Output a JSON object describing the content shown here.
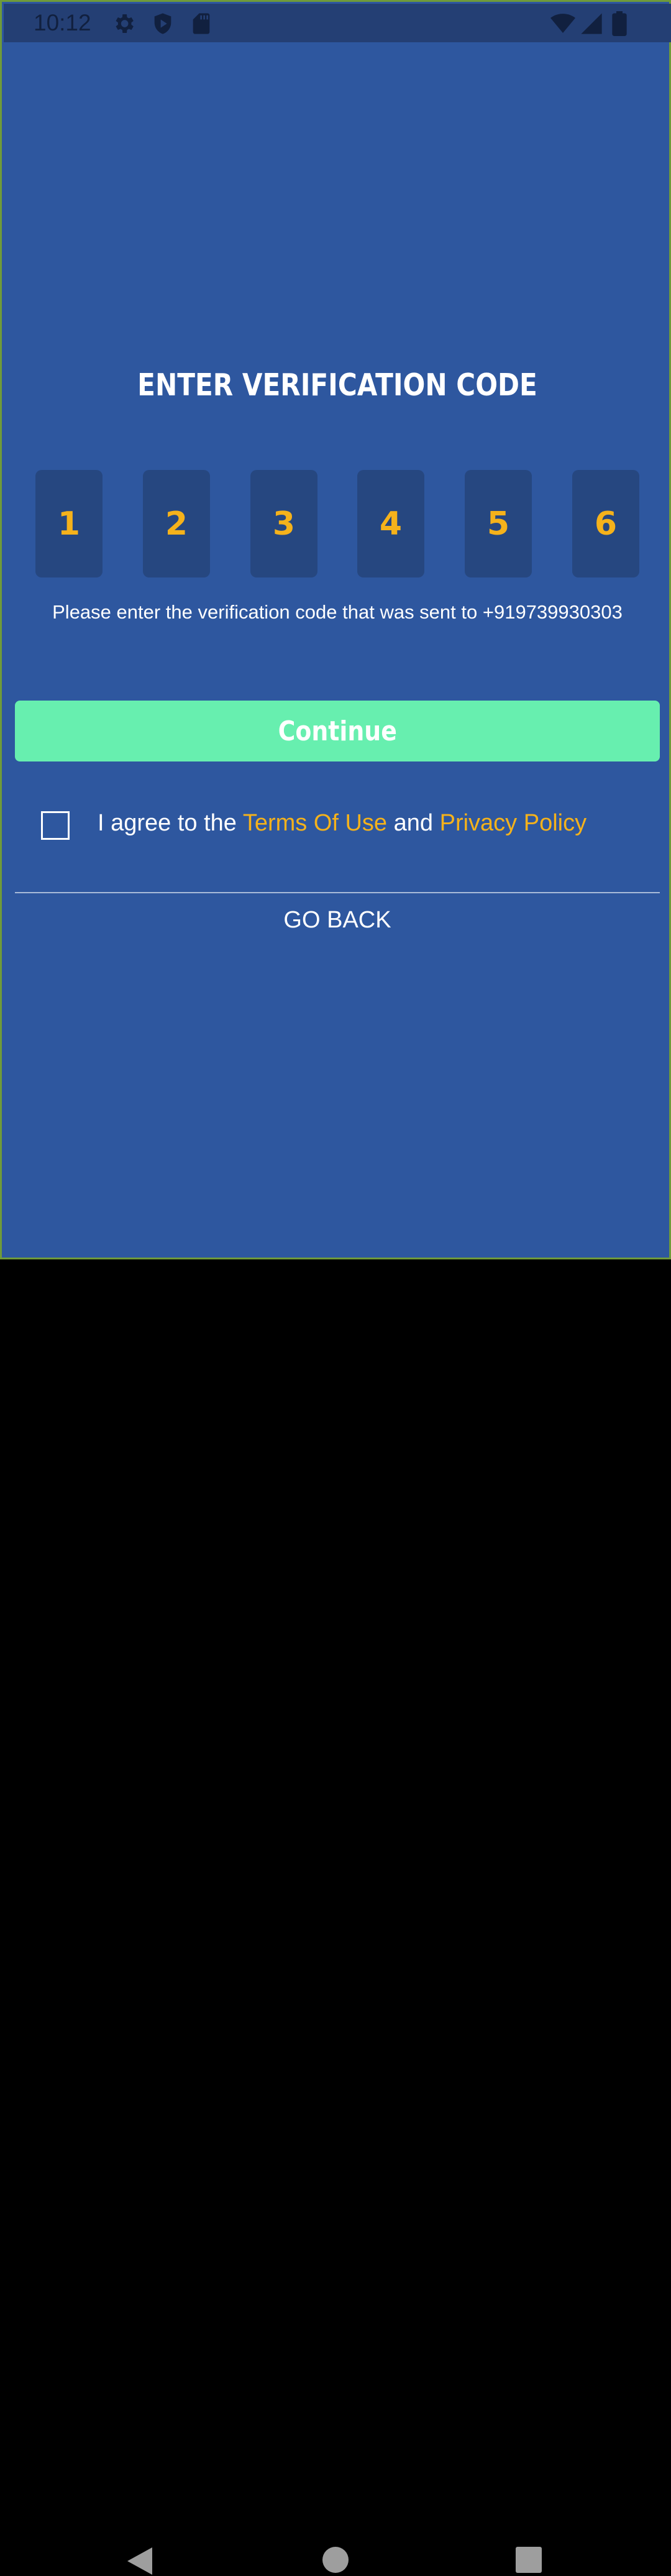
{
  "status_bar": {
    "time": "10:12",
    "icons": [
      "gear-icon",
      "shield-play-icon",
      "sd-card-icon",
      "wifi-icon",
      "signal-icon",
      "battery-icon"
    ]
  },
  "screen": {
    "title": "ENTER VERIFICATION CODE",
    "code_digits": [
      "1",
      "2",
      "3",
      "4",
      "5",
      "6"
    ],
    "info_text": "Please enter the verification code that was sent to +919739930303",
    "continue_label": "Continue",
    "agree": {
      "prefix": "I agree to the ",
      "terms_link": "Terms Of Use",
      "middle": " and ",
      "privacy_link": "Privacy Policy",
      "checked": false
    },
    "go_back_label": "GO BACK"
  },
  "nav_bar": {
    "icons": [
      "back-icon",
      "home-icon",
      "recents-icon"
    ]
  },
  "colors": {
    "background": "#2e579f",
    "status_bar": "#243f74",
    "code_box": "#264780",
    "accent": "#f5b21b",
    "button": "#67efaf"
  }
}
